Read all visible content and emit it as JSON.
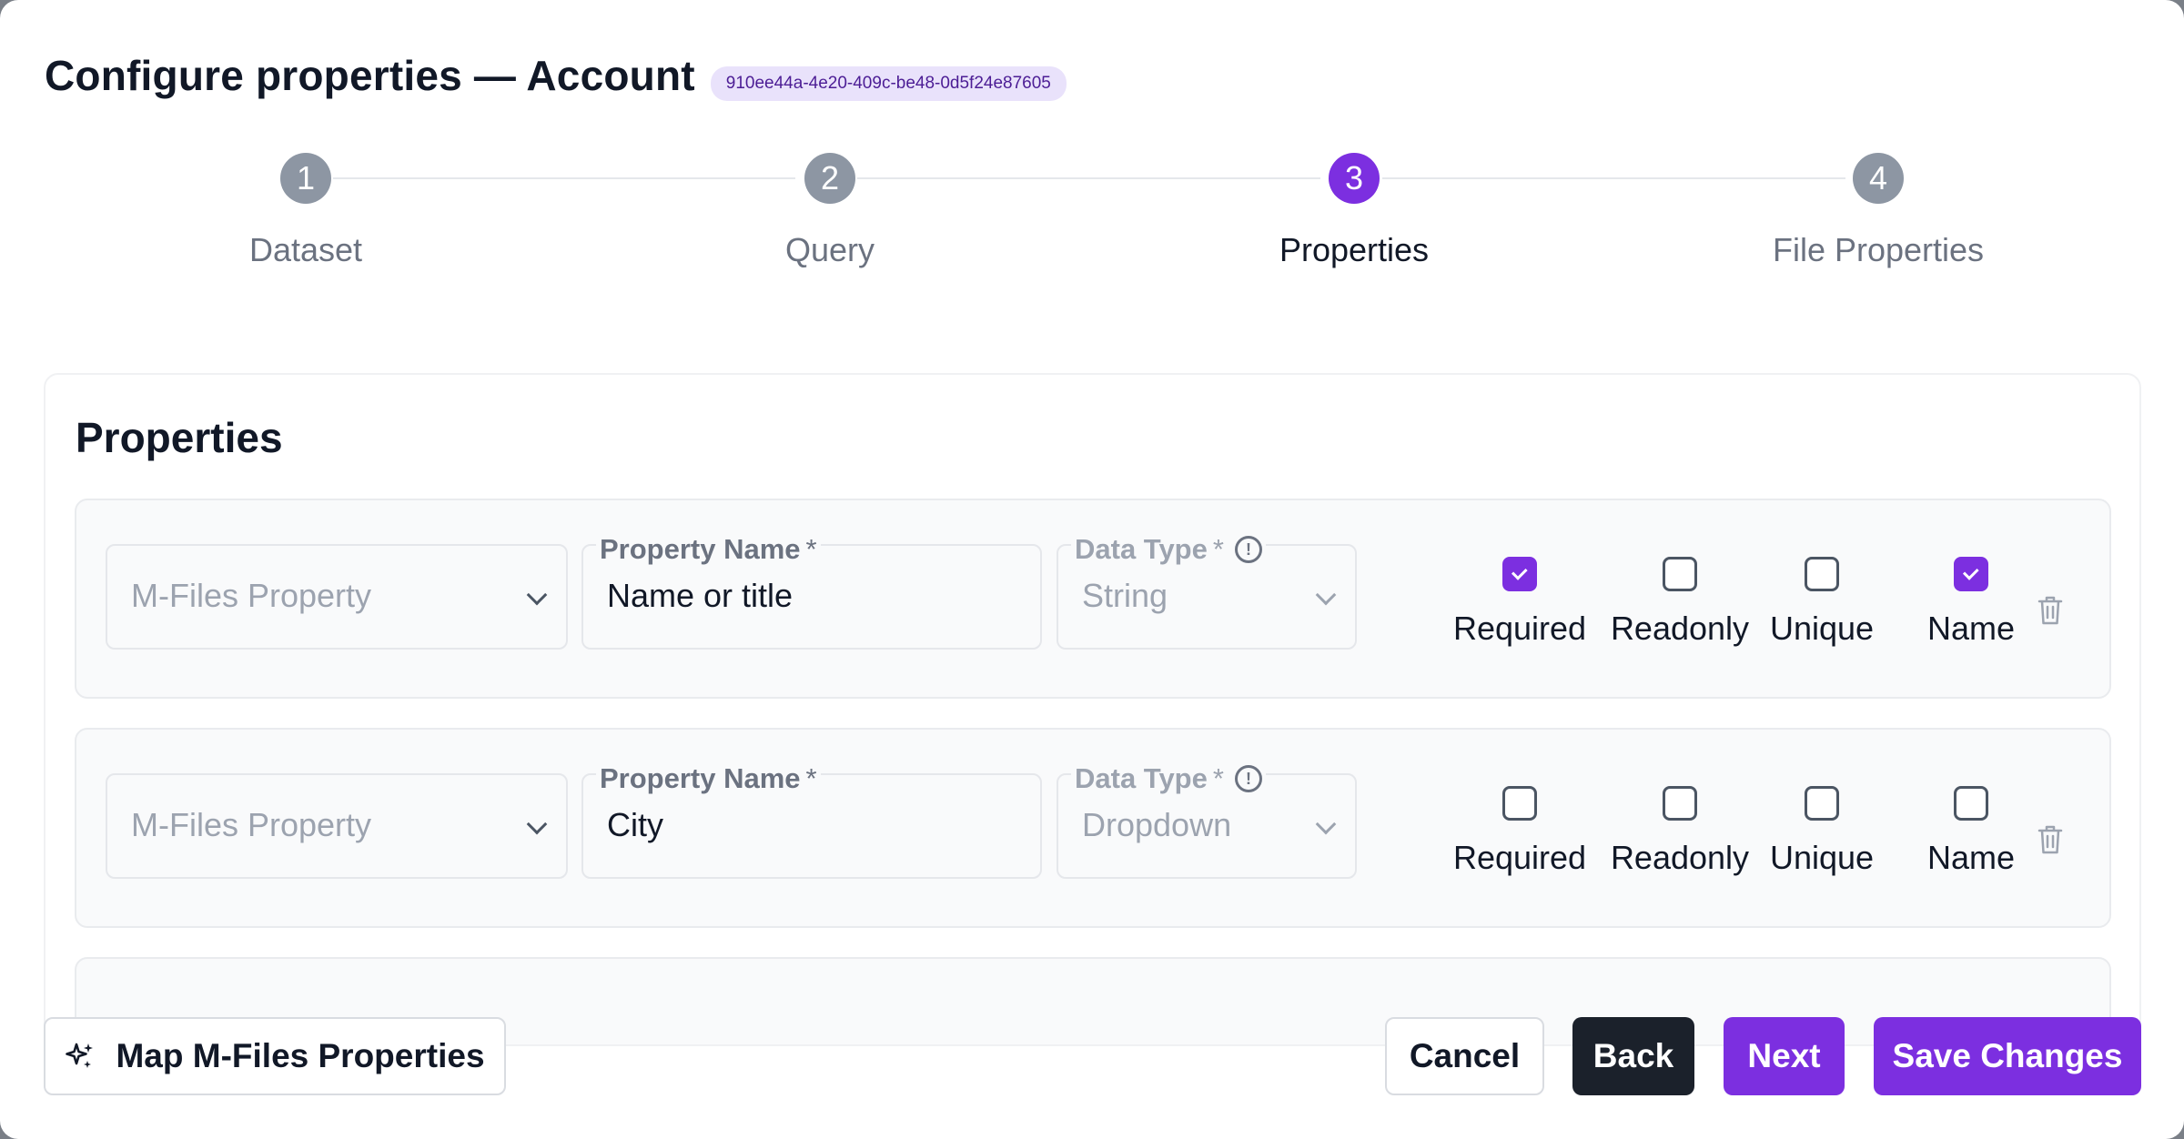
{
  "dialog": {
    "title": "Configure properties — Account",
    "id_badge": "910ee44a-4e20-409c-be48-0d5f24e87605"
  },
  "stepper": {
    "active_step": 3,
    "steps": [
      {
        "number": "1",
        "label": "Dataset"
      },
      {
        "number": "2",
        "label": "Query"
      },
      {
        "number": "3",
        "label": "Properties"
      },
      {
        "number": "4",
        "label": "File Properties"
      }
    ]
  },
  "properties": {
    "title": "Properties",
    "labels": {
      "mfiles_placeholder": "M-Files Property",
      "property_name": "Property Name",
      "data_type": "Data Type",
      "required_marker": "*",
      "info_icon": "!",
      "required": "Required",
      "readonly": "Readonly",
      "unique": "Unique",
      "name": "Name"
    },
    "rows": [
      {
        "property_name": "Name or title",
        "data_type": "String",
        "required": true,
        "readonly": false,
        "unique": false,
        "name": true
      },
      {
        "property_name": "City",
        "data_type": "Dropdown",
        "required": false,
        "readonly": false,
        "unique": false,
        "name": false
      }
    ]
  },
  "footer": {
    "map_label": "Map M-Files Properties",
    "cancel_label": "Cancel",
    "back_label": "Back",
    "next_label": "Next",
    "save_label": "Save Changes"
  },
  "colors": {
    "accent": "#7c2fe0",
    "dark_button": "#1b212b",
    "inactive_step": "#8d96a3",
    "badge_bg": "#e9e2fb"
  },
  "icons": {
    "sparkle": "sparkles-icon",
    "trash": "trash-icon",
    "info": "info-circle-icon",
    "chevron": "chevron-down-icon",
    "check": "check-icon"
  }
}
